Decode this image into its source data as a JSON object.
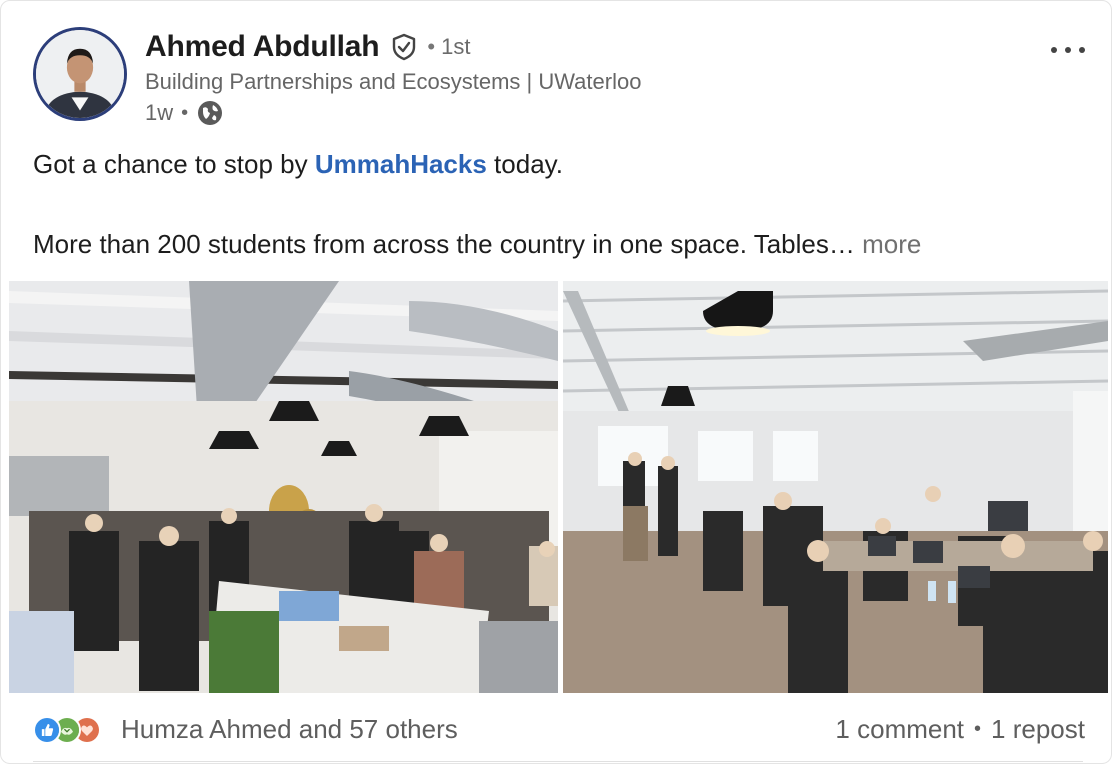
{
  "author": {
    "name": "Ahmed Abdullah",
    "degree": "1st",
    "headline": "Building Partnerships and Ecosystems | UWaterloo",
    "time_ago": "1w",
    "avatar_icon": "profile-photo",
    "verified_icon": "shield-check-icon",
    "visibility_icon": "globe-icon"
  },
  "post": {
    "line1_before": "Got a chance to stop by ",
    "mention": "UmmahHacks",
    "line1_after": " today.",
    "line2": "More than 200 students from across the country in one space. Tables…",
    "see_more": "more"
  },
  "media": {
    "photo_left_icon": "event-photo",
    "photo_right_icon": "event-photo"
  },
  "social": {
    "reactions": [
      "like-icon",
      "support-icon",
      "love-icon"
    ],
    "reactors": "Humza Ahmed and 57 others",
    "comments": "1 comment",
    "reposts": "1 repost"
  },
  "colors": {
    "mention": "#2b63b5",
    "avatar_ring": "#2c3e7a",
    "like": "#378fe9",
    "support": "#6dae4f",
    "love": "#df704d"
  }
}
